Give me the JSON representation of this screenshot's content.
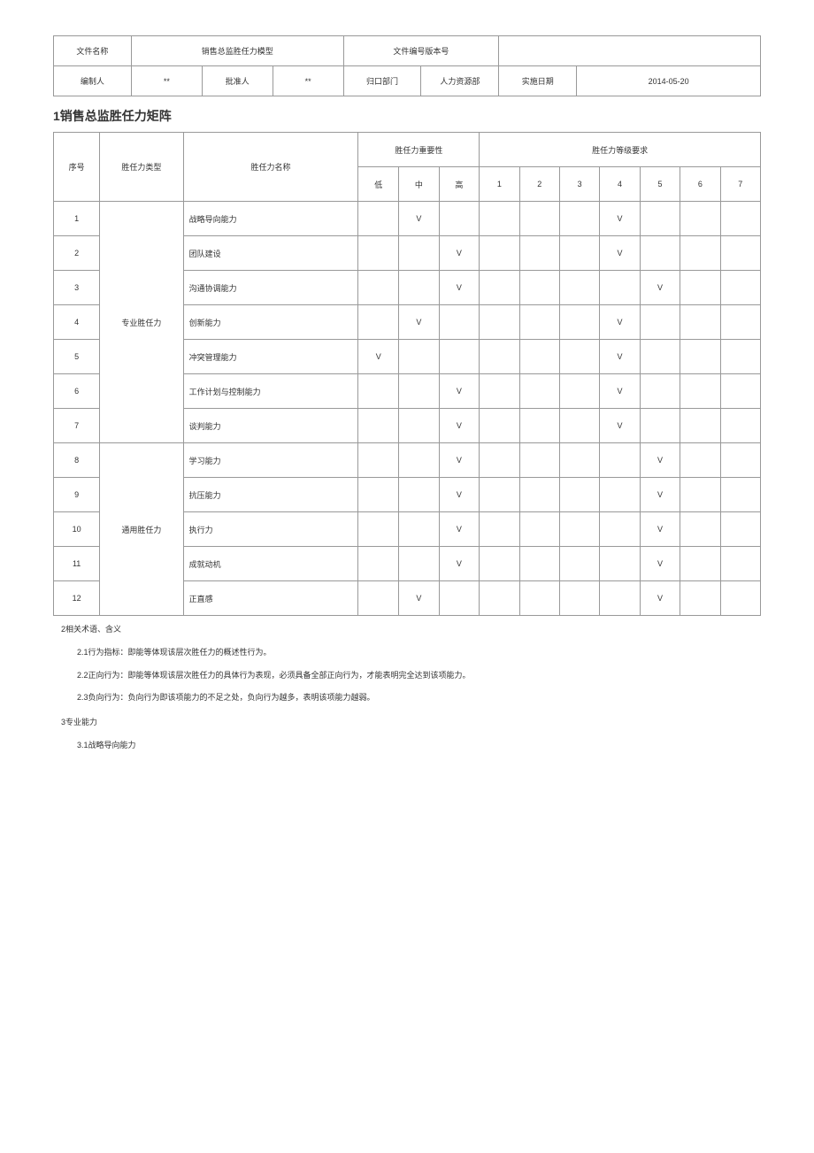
{
  "header": {
    "fileNameLabel": "文件名称",
    "fileNameValue": "销售总监胜任力模型",
    "fileNoLabel": "文件编号版本号",
    "fileNoValue": "",
    "preparedByLabel": "编制人",
    "preparedByValue": "**",
    "approvedByLabel": "批准人",
    "approvedByValue": "**",
    "deptLabel": "归口部门",
    "deptValue": "人力资源部",
    "effectiveDateLabel": "实施日期",
    "effectiveDateValue": "2014-05-20"
  },
  "sectionTitle": "1销售总监胜任力矩阵",
  "matrix": {
    "headers": {
      "seq": "序号",
      "type": "胜任力类型",
      "name": "胜任力名称",
      "importance": "胜任力重要性",
      "level": "胜任力等级要求",
      "low": "低",
      "mid": "中",
      "high": "高",
      "l1": "1",
      "l2": "2",
      "l3": "3",
      "l4": "4",
      "l5": "5",
      "l6": "6",
      "l7": "7"
    },
    "groups": [
      {
        "type": "专业胜任力",
        "rows": [
          {
            "seq": "1",
            "name": "战略导向能力",
            "imp": {
              "low": "",
              "mid": "V",
              "high": ""
            },
            "lvl": {
              "1": "",
              "2": "",
              "3": "",
              "4": "V",
              "5": "",
              "6": "",
              "7": ""
            }
          },
          {
            "seq": "2",
            "name": "团队建设",
            "imp": {
              "low": "",
              "mid": "",
              "high": "V"
            },
            "lvl": {
              "1": "",
              "2": "",
              "3": "",
              "4": "V",
              "5": "",
              "6": "",
              "7": ""
            }
          },
          {
            "seq": "3",
            "name": "沟通协调能力",
            "imp": {
              "low": "",
              "mid": "",
              "high": "V"
            },
            "lvl": {
              "1": "",
              "2": "",
              "3": "",
              "4": "",
              "5": "V",
              "6": "",
              "7": ""
            }
          },
          {
            "seq": "4",
            "name": "创新能力",
            "imp": {
              "low": "",
              "mid": "V",
              "high": ""
            },
            "lvl": {
              "1": "",
              "2": "",
              "3": "",
              "4": "V",
              "5": "",
              "6": "",
              "7": ""
            }
          },
          {
            "seq": "5",
            "name": "冲突管理能力",
            "imp": {
              "low": "V",
              "mid": "",
              "high": ""
            },
            "lvl": {
              "1": "",
              "2": "",
              "3": "",
              "4": "V",
              "5": "",
              "6": "",
              "7": ""
            }
          },
          {
            "seq": "6",
            "name": "工作计划与控制能力",
            "imp": {
              "low": "",
              "mid": "",
              "high": "V"
            },
            "lvl": {
              "1": "",
              "2": "",
              "3": "",
              "4": "V",
              "5": "",
              "6": "",
              "7": ""
            }
          },
          {
            "seq": "7",
            "name": "谈判能力",
            "imp": {
              "low": "",
              "mid": "",
              "high": "V"
            },
            "lvl": {
              "1": "",
              "2": "",
              "3": "",
              "4": "V",
              "5": "",
              "6": "",
              "7": ""
            }
          }
        ]
      },
      {
        "type": "通用胜任力",
        "rows": [
          {
            "seq": "8",
            "name": "学习能力",
            "imp": {
              "low": "",
              "mid": "",
              "high": "V"
            },
            "lvl": {
              "1": "",
              "2": "",
              "3": "",
              "4": "",
              "5": "V",
              "6": "",
              "7": ""
            }
          },
          {
            "seq": "9",
            "name": "抗压能力",
            "imp": {
              "low": "",
              "mid": "",
              "high": "V"
            },
            "lvl": {
              "1": "",
              "2": "",
              "3": "",
              "4": "",
              "5": "V",
              "6": "",
              "7": ""
            }
          },
          {
            "seq": "10",
            "name": "执行力",
            "imp": {
              "low": "",
              "mid": "",
              "high": "V"
            },
            "lvl": {
              "1": "",
              "2": "",
              "3": "",
              "4": "",
              "5": "V",
              "6": "",
              "7": ""
            }
          },
          {
            "seq": "11",
            "name": "成就动机",
            "imp": {
              "low": "",
              "mid": "",
              "high": "V"
            },
            "lvl": {
              "1": "",
              "2": "",
              "3": "",
              "4": "",
              "5": "V",
              "6": "",
              "7": ""
            }
          },
          {
            "seq": "12",
            "name": "正直感",
            "imp": {
              "low": "",
              "mid": "V",
              "high": ""
            },
            "lvl": {
              "1": "",
              "2": "",
              "3": "",
              "4": "",
              "5": "V",
              "6": "",
              "7": ""
            }
          }
        ]
      }
    ]
  },
  "notes": {
    "term": "2相关术语、含义",
    "n21": "2.1行为指标：即能等体现该层次胜任力的概述性行为。",
    "n22": "2.2正向行为：即能等体现该层次胜任力的具体行为表现，必须具备全部正向行为，才能表明完全达到该项能力。",
    "n23": "2.3负向行为：负向行为即该项能力的不足之处，负向行为越多，表明该项能力越弱。",
    "s3": "3专业能力",
    "s31": "3.1战略导向能力"
  }
}
